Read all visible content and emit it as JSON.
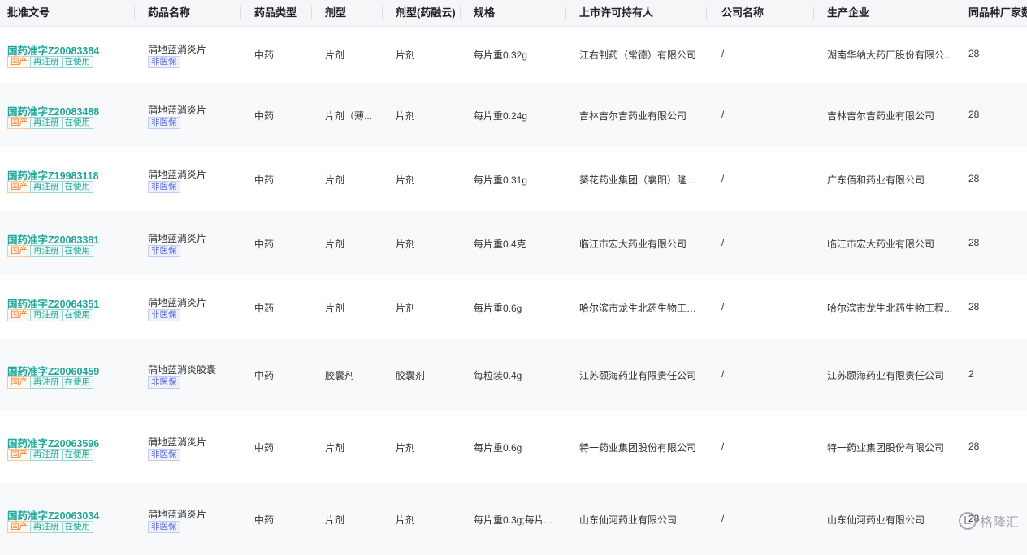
{
  "headers": [
    "批准文号",
    "药品名称",
    "药品类型",
    "剂型",
    "剂型(药融云)",
    "规格",
    "上市许可持有人",
    "公司名称",
    "生产企业",
    "同品种厂家数"
  ],
  "tags": {
    "domestic": "国产",
    "reregistered": "再注册",
    "in_use": "在使用",
    "non_insurance": "非医保"
  },
  "rows": [
    {
      "approval": "国药准字Z20083384",
      "name": "蒲地蓝消炎片",
      "type": "中药",
      "form": "片剂",
      "form_yry": "片剂",
      "spec": "每片重0.32g",
      "holder": "江右制药（常德）有限公司",
      "company": "/",
      "manufacturer": "湖南华纳大药厂股份有限公...",
      "count": "28"
    },
    {
      "approval": "国药准字Z20083488",
      "name": "蒲地蓝消炎片",
      "type": "中药",
      "form": "片剂（薄...",
      "form_yry": "片剂",
      "spec": "每片重0.24g",
      "holder": "吉林吉尔吉药业有限公司",
      "company": "/",
      "manufacturer": "吉林吉尔吉药业有限公司",
      "count": "28"
    },
    {
      "approval": "国药准字Z19983118",
      "name": "蒲地蓝消炎片",
      "type": "中药",
      "form": "片剂",
      "form_yry": "片剂",
      "spec": "每片重0.31g",
      "holder": "葵花药业集团（襄阳）隆中...",
      "company": "/",
      "manufacturer": "广东佰和药业有限公司",
      "count": "28"
    },
    {
      "approval": "国药准字Z20083381",
      "name": "蒲地蓝消炎片",
      "type": "中药",
      "form": "片剂",
      "form_yry": "片剂",
      "spec": "每片重0.4克",
      "holder": "临江市宏大药业有限公司",
      "company": "/",
      "manufacturer": "临江市宏大药业有限公司",
      "count": "28"
    },
    {
      "approval": "国药准字Z20064351",
      "name": "蒲地蓝消炎片",
      "type": "中药",
      "form": "片剂",
      "form_yry": "片剂",
      "spec": "每片重0.6g",
      "holder": "哈尔滨市龙生北药生物工程...",
      "company": "/",
      "manufacturer": "哈尔滨市龙生北药生物工程...",
      "count": "28"
    },
    {
      "approval": "国药准字Z20060459",
      "name": "蒲地蓝消炎胶囊",
      "type": "中药",
      "form": "胶囊剂",
      "form_yry": "胶囊剂",
      "spec": "每粒装0.4g",
      "holder": "江苏颐海药业有限责任公司",
      "company": "/",
      "manufacturer": "江苏颐海药业有限责任公司",
      "count": "2"
    },
    {
      "approval": "国药准字Z20063596",
      "name": "蒲地蓝消炎片",
      "type": "中药",
      "form": "片剂",
      "form_yry": "片剂",
      "spec": "每片重0.6g",
      "holder": "特一药业集团股份有限公司",
      "company": "/",
      "manufacturer": "特一药业集团股份有限公司",
      "count": "28"
    },
    {
      "approval": "国药准字Z20063034",
      "name": "蒲地蓝消炎片",
      "type": "中药",
      "form": "片剂",
      "form_yry": "片剂",
      "spec": "每片重0.3g;每片...",
      "holder": "山东仙河药业有限公司",
      "company": "/",
      "manufacturer": "山东仙河药业有限公司",
      "count": "28"
    }
  ],
  "watermark": {
    "text": "格隆汇",
    "icon": "gelonghui-logo-icon"
  }
}
